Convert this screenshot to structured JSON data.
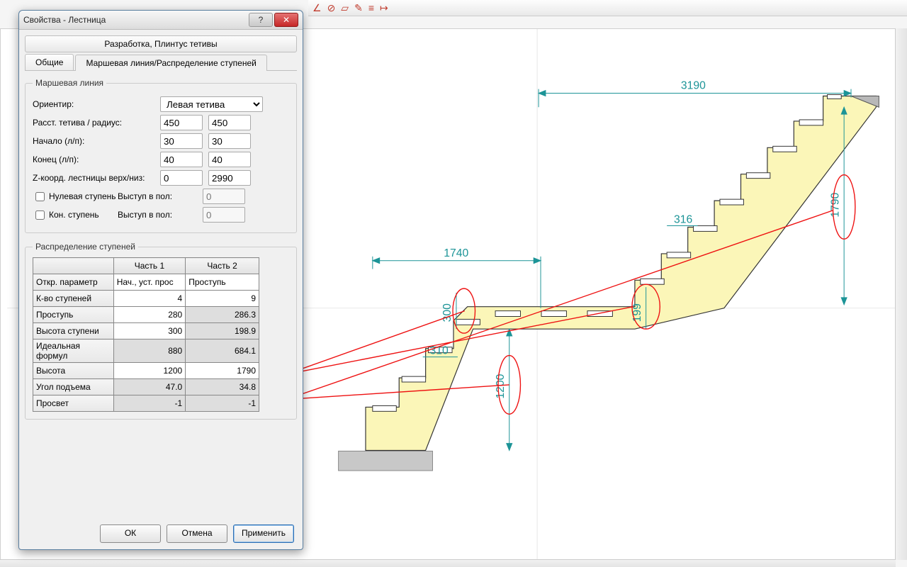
{
  "dialog": {
    "title": "Свойства - Лестница",
    "tabtop": "Разработка, Плинтус тетивы",
    "tabs": {
      "common": "Общие",
      "march": "Маршевая линия/Распределение ступеней"
    },
    "march_line": {
      "legend": "Маршевая линия",
      "orient_label": "Ориентир:",
      "orient_value": "Левая тетива",
      "dist_label": "Расст. тетива / радиус:",
      "dist_a": "450",
      "dist_b": "450",
      "start_label": "Начало (л/п):",
      "start_a": "30",
      "start_b": "30",
      "end_label": "Конец (л/п):",
      "end_a": "40",
      "end_b": "40",
      "z_label": "Z-коорд. лестницы верх/низ:",
      "z_a": "0",
      "z_b": "2990",
      "nullstep": "Нулевая ступень",
      "endstep": "Кон. ступень",
      "proj_label": "Выступ в пол:",
      "proj_a": "0",
      "proj_b": "0"
    },
    "distrib": {
      "legend": "Распределение ступеней",
      "headers": {
        "p1": "Часть 1",
        "p2": "Часть 2"
      },
      "rows": [
        {
          "label": "Откр. параметр",
          "v1": "Нач., уст. прос",
          "v2": "Проступь"
        },
        {
          "label": "К-во ступеней",
          "v1": "4",
          "v2": "9"
        },
        {
          "label": "Проступь",
          "v1": "280",
          "v2": "286.3"
        },
        {
          "label": "Высота ступени",
          "v1": "300",
          "v2": "198.9"
        },
        {
          "label": "Идеальная формул",
          "v1": "880",
          "v2": "684.1"
        },
        {
          "label": "Высота",
          "v1": "1200",
          "v2": "1790"
        },
        {
          "label": "Угол подъема",
          "v1": "47.0",
          "v2": "34.8"
        },
        {
          "label": "Просвет",
          "v1": "-1",
          "v2": "-1"
        }
      ]
    },
    "buttons": {
      "ok": "ОК",
      "cancel": "Отмена",
      "apply": "Применить"
    }
  },
  "canvas": {
    "dims": {
      "top_total": "3190",
      "right_total": "1790",
      "mid_len": "1740",
      "mid_step": "316",
      "left_run": "310",
      "left_rise": "300",
      "left_height": "1200",
      "mid_rise": "199"
    }
  }
}
